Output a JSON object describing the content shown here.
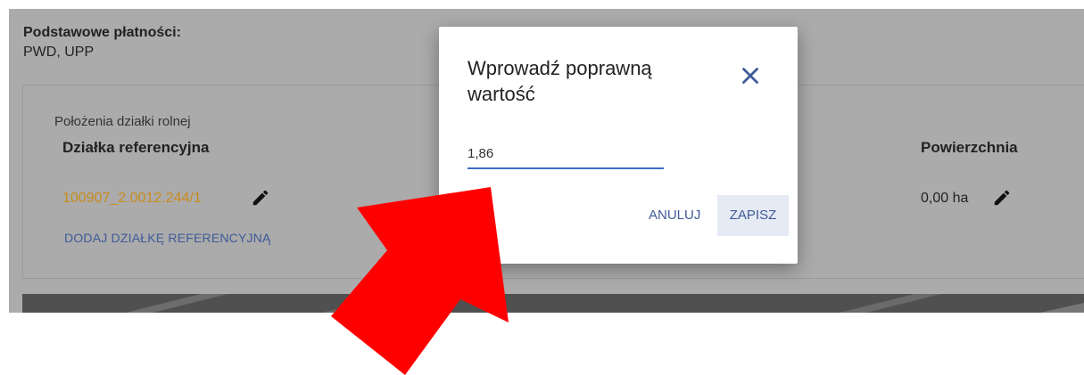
{
  "background": {
    "payments_title": "Podstawowe płatności:",
    "payments_value": "PWD, UPP",
    "plot_caption": "Położenia działki rolnej",
    "col_reference": "Działka referencyjna",
    "col_area": "Powierzchnia",
    "reference_parcel": "100907_2.0012.244/1",
    "area_value": "0,00 ha",
    "add_reference": "DODAJ DZIAŁKĘ REFERENCYJNĄ"
  },
  "dialog": {
    "title": "Wprowadź poprawną wartość",
    "input_value": "1,86",
    "cancel_label": "ANULUJ",
    "save_label": "ZAPISZ"
  },
  "icons": {
    "close": "close-icon",
    "edit": "pencil-icon",
    "annotation": "red-arrow"
  },
  "colors": {
    "accent": "#3f5a98",
    "link": "#c88c1c",
    "overlay": "#ababab",
    "arrow": "#ff0000"
  }
}
